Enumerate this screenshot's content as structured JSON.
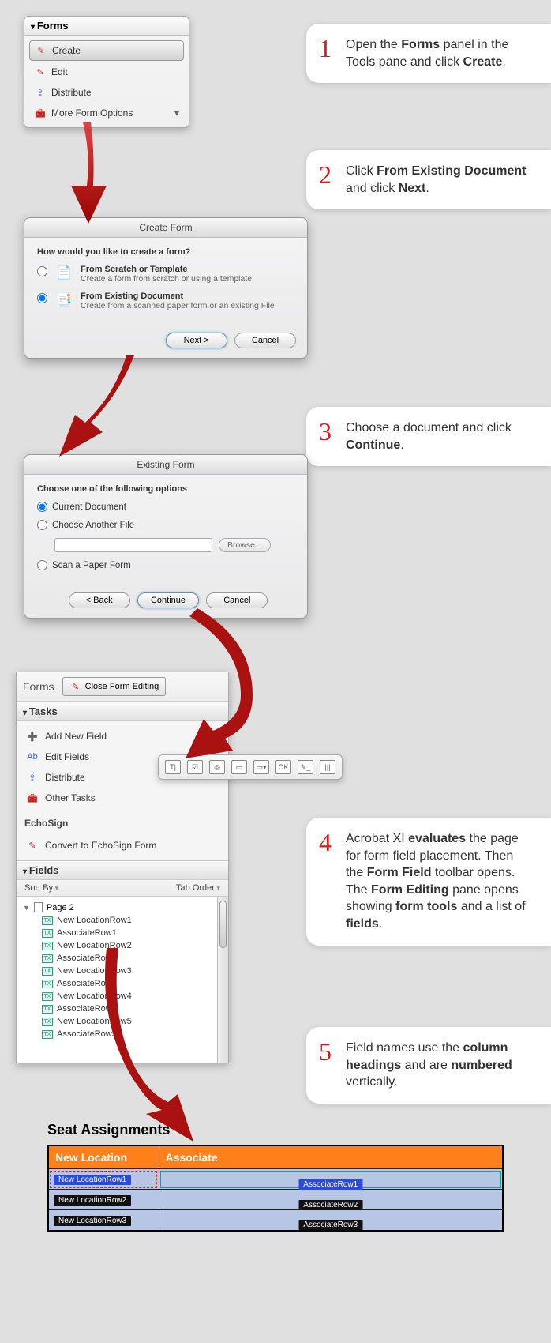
{
  "callouts": {
    "c1": {
      "num": "1",
      "pre": "Open the ",
      "b1": "Forms",
      "mid": " panel in the Tools pane and click ",
      "b2": "Create",
      "post": "."
    },
    "c2": {
      "num": "2",
      "pre": "Click ",
      "b1": "From Existing Document",
      "mid": " and click ",
      "b2": "Next",
      "post": "."
    },
    "c3": {
      "num": "3",
      "pre": "Choose a document and click ",
      "b1": "Continue",
      "post": "."
    },
    "c4": {
      "num": "4",
      "pre": "Acrobat XI ",
      "b1": "evaluates",
      "t1": " the page for form field placement. Then the ",
      "b2": "Form Field",
      "t2": " toolbar opens. The ",
      "b3": "Form Editing",
      "t3": " pane opens showing ",
      "b4": "form tools",
      "t4": " and a list of ",
      "b5": "fields",
      "t5": "."
    },
    "c5": {
      "num": "5",
      "pre": "Field names use the ",
      "b1": "column headings",
      "mid": " and are ",
      "b2": "numbered",
      "post": " vertically."
    }
  },
  "forms_panel": {
    "title": "Forms",
    "items": [
      {
        "label": "Create",
        "sel": true
      },
      {
        "label": "Edit"
      },
      {
        "label": "Distribute"
      },
      {
        "label": "More Form Options",
        "chev": true
      }
    ]
  },
  "create_dialog": {
    "title": "Create Form",
    "question": "How would you like to create a form?",
    "opt1_title": "From Scratch or Template",
    "opt1_sub": "Create a form from scratch or using a template",
    "opt2_title": "From Existing Document",
    "opt2_sub": "Create from a scanned paper form or an existing File",
    "next": "Next >",
    "cancel": "Cancel"
  },
  "exist_dialog": {
    "title": "Existing Form",
    "question": "Choose one of the following options",
    "r1": "Current Document",
    "r2": "Choose Another File",
    "browse": "Browse...",
    "r3": "Scan a Paper Form",
    "back": "< Back",
    "cont": "Continue",
    "cancel": "Cancel"
  },
  "edit_pane": {
    "top_title": "Forms",
    "close": "Close Form Editing",
    "tasks_header": "Tasks",
    "tasks": [
      "Add New Field",
      "Edit Fields",
      "Distribute",
      "Other Tasks"
    ],
    "echo_label": "EchoSign",
    "echo_item": "Convert to EchoSign Form",
    "fields_header": "Fields",
    "sort_by": "Sort By",
    "tab_order": "Tab Order",
    "page_label": "Page 2",
    "fields": [
      "New LocationRow1",
      "AssociateRow1",
      "New LocationRow2",
      "AssociateRow2",
      "New LocationRow3",
      "AssociateRow3",
      "New LocationRow4",
      "AssociateRow4",
      "New LocationRow5",
      "AssociateRow5"
    ]
  },
  "toolbar_icons": [
    "T|",
    "☑",
    "◎",
    "▭",
    "▭▾",
    "OK",
    "✎_",
    "|||"
  ],
  "seat": {
    "title": "Seat Assignments",
    "col1": "New Location",
    "col2": "Associate",
    "rows": [
      {
        "loc": "New LocationRow1",
        "assoc": "AssociateRow1"
      },
      {
        "loc": "New LocationRow2",
        "assoc": "AssociateRow2"
      },
      {
        "loc": "New LocationRow3",
        "assoc": "AssociateRow3"
      }
    ]
  }
}
